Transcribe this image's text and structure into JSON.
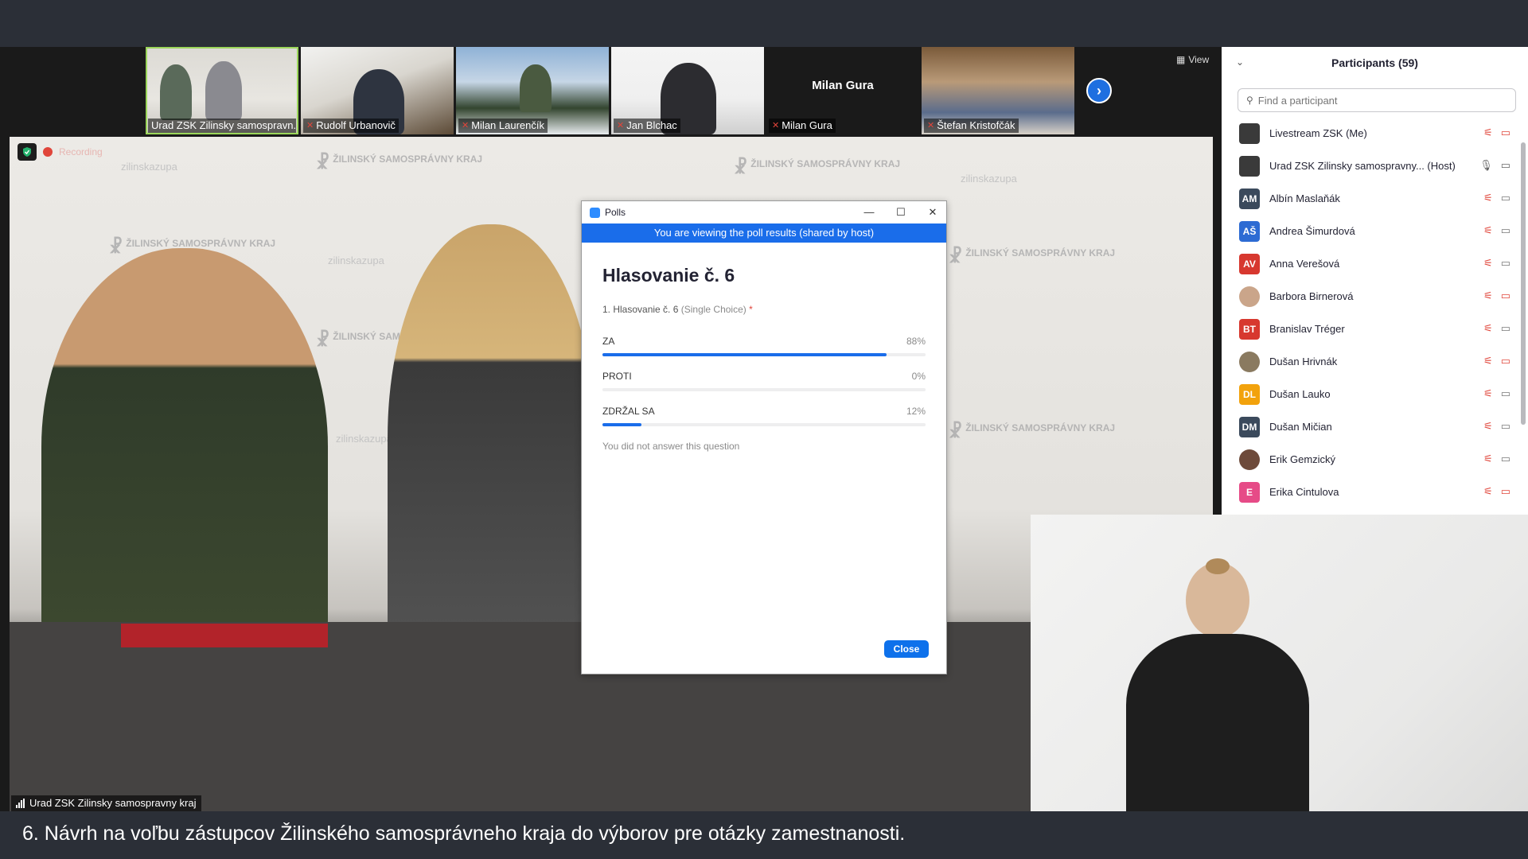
{
  "thumbnails": [
    {
      "name": "Urad ZSK Zilinsky samospravn...",
      "muted": false,
      "active": true
    },
    {
      "name": "Rudolf Urbanovič",
      "muted": true,
      "active": false
    },
    {
      "name": "Milan Laurenčík",
      "muted": true,
      "active": false
    },
    {
      "name": "Jan Blchac",
      "muted": true,
      "active": false
    },
    {
      "name": "Milan Gura",
      "muted": true,
      "active": false,
      "center_text": "Milan Gura"
    },
    {
      "name": "Štefan Kristofčák",
      "muted": true,
      "active": false
    }
  ],
  "view_label": "View",
  "recording_label": "Recording",
  "main_video_label": "Urad ZSK Zilinsky samospravny kraj",
  "watermarks": [
    "zilinskazupa",
    "ŽILINSKÝ SAMOSPRÁVNY KRAJ"
  ],
  "participants": {
    "title": "Participants (59)",
    "search_placeholder": "Find a participant",
    "items": [
      {
        "name": "Livestream ZSK (Me)",
        "initials": "",
        "color": "#3a3a3a"
      },
      {
        "name": "Urad ZSK Zilinsky samospravny... (Host)",
        "initials": "",
        "color": "#3a3a3a"
      },
      {
        "name": "Albín Maslaňák",
        "initials": "AM",
        "color": "#3b4a5c"
      },
      {
        "name": "Andrea Šimurdová",
        "initials": "AŠ",
        "color": "#2d6bd3"
      },
      {
        "name": "Anna Verešová",
        "initials": "AV",
        "color": "#d7382f"
      },
      {
        "name": "Barbora Birnerová",
        "initials": "",
        "color": "#caa58a"
      },
      {
        "name": "Branislav Tréger",
        "initials": "BT",
        "color": "#d7382f"
      },
      {
        "name": "Dušan Hrivnák",
        "initials": "",
        "color": "#8a7a60"
      },
      {
        "name": "Dušan Lauko",
        "initials": "DL",
        "color": "#f2a20c"
      },
      {
        "name": "Dušan Mičian",
        "initials": "DM",
        "color": "#3b4a5c"
      },
      {
        "name": "Erik Gemzický",
        "initials": "",
        "color": "#6d4a3a"
      },
      {
        "name": "Erika Cintulova",
        "initials": "E",
        "color": "#e64b87"
      }
    ]
  },
  "poll": {
    "window_title": "Polls",
    "banner": "You are viewing the poll results (shared by host)",
    "heading": "Hlasovanie č. 6",
    "question": "1. Hlasovanie č. 6",
    "question_type": "(Single Choice)",
    "required_mark": "*",
    "options": [
      {
        "label": "ZA",
        "percent_text": "88%",
        "percent": 88
      },
      {
        "label": "PROTI",
        "percent_text": "0%",
        "percent": 0
      },
      {
        "label": "ZDRŽAL SA",
        "percent_text": "12%",
        "percent": 12
      }
    ],
    "note": "You did not answer this question",
    "close_label": "Close"
  },
  "subtitle": "6. Návrh na voľbu zástupcov Žilinského samosprávneho kraja do výborov pre otázky zamestnanosti."
}
